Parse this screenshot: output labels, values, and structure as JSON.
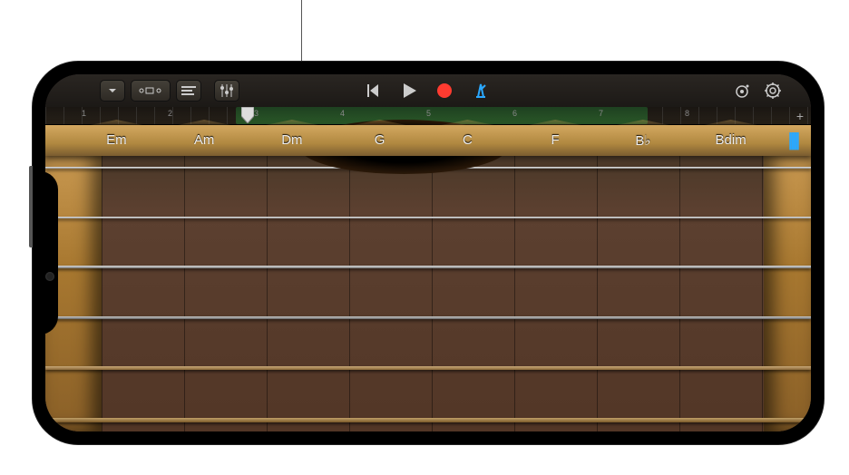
{
  "toolbar": {
    "left": {
      "browser_label": "browser",
      "view_label": "view",
      "fx_label": "track-fx",
      "mixer_label": "mixer"
    },
    "transport": {
      "rewind": "rewind",
      "play": "play",
      "record": "record",
      "metronome": "metronome"
    },
    "right": {
      "tone": "tone",
      "settings": "settings"
    }
  },
  "ruler": {
    "bars": [
      "1",
      "2",
      "3",
      "4",
      "5",
      "6",
      "7",
      "8"
    ],
    "add": "+"
  },
  "chords": [
    "Em",
    "Am",
    "Dm",
    "G",
    "C",
    "F",
    "B♭",
    "Bdim"
  ],
  "mode": {
    "autoplay_icon": "||||"
  },
  "colors": {
    "accent_blue": "#2aa8ff",
    "record_red": "#ff3b30"
  }
}
